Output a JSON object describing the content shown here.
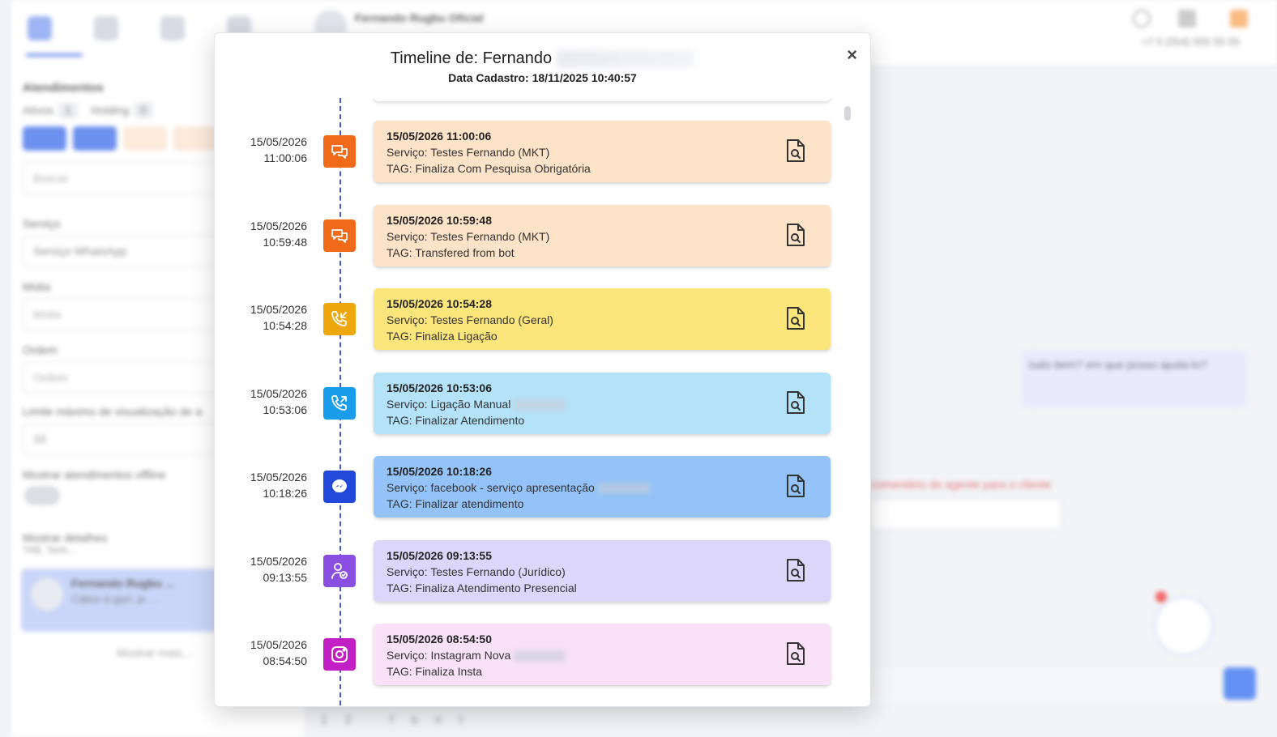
{
  "background": {
    "left_panel": {
      "section_title": "Atendimentos",
      "active_label": "Ativos",
      "active_count": "1",
      "holding_label": "Holding",
      "holding_count": "0",
      "search_placeholder": "Buscar",
      "service_label": "Serviço",
      "service_value": "Serviço WhatsApp",
      "midia_label": "Mídia",
      "midia_placeholder": "Mídia",
      "ordem_label": "Ordem",
      "ordem_placeholder": "Ordem",
      "limit_label": "Limite máximo de visualização de a",
      "limit_value": "10",
      "offline_label": "Mostrar atendimentos offline",
      "details_label": "Mostrar detalhes",
      "details_sub": "TAB, Tanh...",
      "card_name": "Fernando Rugbu ...",
      "card_preview": "Cabra si gurí, jo ...",
      "show_more": "Mostrar mais..."
    },
    "chat": {
      "contact_name": "Fernando Rugbu Oficial",
      "phone": "+7 5 (554) 555 55 55",
      "message_text": "tudo bem? em que posso ajuda-lo?",
      "red_note": "comentário do agente para o cliente",
      "bottom_hint": "12 font"
    }
  },
  "modal": {
    "title": "Timeline de: Fernando",
    "subtitle": "Data Cadastro: 18/11/2025 10:40:57",
    "close_label": "×",
    "entries": [
      {
        "date": "15/05/2026",
        "time": "11:00:06",
        "card_time": "15/05/2026 11:00:06",
        "service": "Serviço: Testes Fernando (MKT)",
        "tag": "TAG: Finaliza Com Pesquisa Obrigatória",
        "icon": "chat-bubbles-icon",
        "icon_color": "#f06a1a",
        "card_color": "#fde3c8"
      },
      {
        "date": "15/05/2026",
        "time": "10:59:48",
        "card_time": "15/05/2026 10:59:48",
        "service": "Serviço: Testes Fernando (MKT)",
        "tag": "TAG: Transfered from bot",
        "icon": "chat-bubbles-icon",
        "icon_color": "#f06a1a",
        "card_color": "#fde3c8"
      },
      {
        "date": "15/05/2026",
        "time": "10:54:28",
        "card_time": "15/05/2026 10:54:28",
        "service": "Serviço: Testes Fernando (Geral)",
        "tag": "TAG: Finaliza Ligação",
        "icon": "phone-incoming-icon",
        "icon_color": "#eea70c",
        "card_color": "#fce57a"
      },
      {
        "date": "15/05/2026",
        "time": "10:53:06",
        "card_time": "15/05/2026 10:53:06",
        "service": "Serviço: Ligação Manual",
        "tag": "TAG: Finalizar Atendimento",
        "icon": "phone-outgoing-icon",
        "icon_color": "#1a9cec",
        "card_color": "#b4e2f8"
      },
      {
        "date": "15/05/2026",
        "time": "10:18:26",
        "card_time": "15/05/2026 10:18:26",
        "service": "Serviço: facebook - serviço apresentação",
        "tag": "TAG: Finalizar atendimento",
        "icon": "messenger-icon",
        "icon_color": "#2148d8",
        "card_color": "#93c3f9"
      },
      {
        "date": "15/05/2026",
        "time": "09:13:55",
        "card_time": "15/05/2026 09:13:55",
        "service": "Serviço: Testes Fernando (Jurídico)",
        "tag": "TAG: Finaliza Atendimento Presencial",
        "icon": "user-check-icon",
        "icon_color": "#8a4ee0",
        "card_color": "#ddd6fb"
      },
      {
        "date": "15/05/2026",
        "time": "08:54:50",
        "card_time": "15/05/2026 08:54:50",
        "service": "Serviço: Instagram Nova",
        "tag": "TAG: Finaliza Insta",
        "icon": "instagram-icon",
        "icon_color": "#c21fc4",
        "card_color": "#f9e1f8"
      }
    ]
  }
}
